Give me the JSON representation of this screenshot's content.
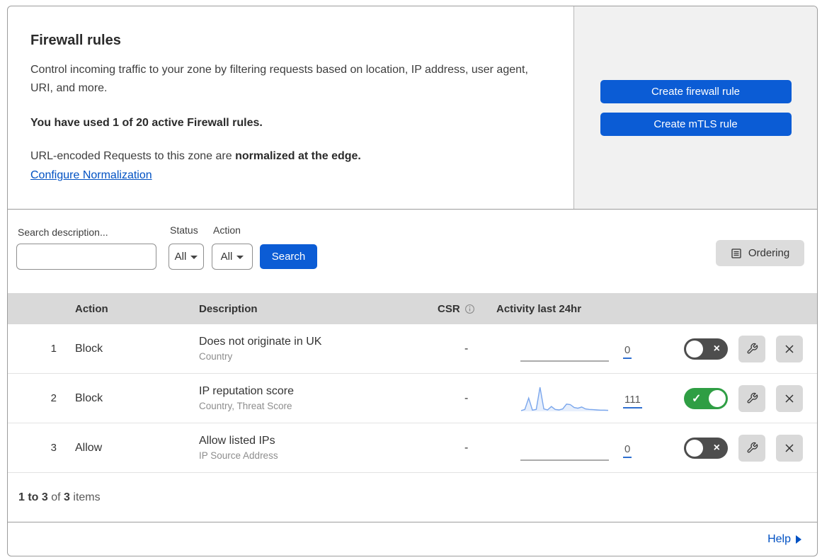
{
  "header": {
    "title": "Firewall rules",
    "description": "Control incoming traffic to your zone by filtering requests based on location, IP address, user agent, URI, and more.",
    "usage_notice": "You have used 1 of 20 active Firewall rules.",
    "normalization_prefix": "URL-encoded Requests to this zone are ",
    "normalization_bold": "normalized at the edge.",
    "normalization_link": "Configure Normalization",
    "buttons": {
      "create_firewall": "Create firewall rule",
      "create_mtls": "Create mTLS rule"
    }
  },
  "filters": {
    "search_label": "Search description...",
    "status_label": "Status",
    "status_value": "All",
    "action_label": "Action",
    "action_value": "All",
    "search_button": "Search",
    "ordering_button": "Ordering"
  },
  "table": {
    "columns": {
      "action": "Action",
      "description": "Description",
      "csr": "CSR",
      "activity": "Activity last 24hr"
    },
    "rows": [
      {
        "priority": "1",
        "action": "Block",
        "description": "Does not originate in UK",
        "criteria": "Country",
        "csr": "-",
        "activity_count": "0",
        "enabled": false
      },
      {
        "priority": "2",
        "action": "Block",
        "description": "IP reputation score",
        "criteria": "Country, Threat Score",
        "csr": "-",
        "activity_count": "111",
        "enabled": true
      },
      {
        "priority": "3",
        "action": "Allow",
        "description": "Allow listed IPs",
        "criteria": "IP Source Address",
        "csr": "-",
        "activity_count": "0",
        "enabled": false
      }
    ]
  },
  "footer": {
    "range_bold": "1 to 3",
    "of_text": " of ",
    "total_bold": "3",
    "items_text": " items",
    "help": "Help"
  },
  "ui": {
    "toggle_on_glyph": "✓",
    "toggle_off_glyph": "×"
  },
  "colors": {
    "primary_button_blue": "#0b5cd5",
    "link_blue": "#0051c3",
    "toggle_on_green": "#2f9e44",
    "toggle_off_gray": "#4d4d4d",
    "table_header_gray": "#d9d9d9",
    "side_panel_gray": "#f1f1f1",
    "sparkline_blue": "#7aa6ec"
  },
  "chart_data": {
    "type": "line",
    "title": "Activity last 24hr sparklines (one per firewall rule)",
    "xlabel": "time, last 24hr (unlabeled)",
    "ylabel": "requests (unlabeled)",
    "axes_hidden": true,
    "legend": false,
    "ylim_relative": [
      0,
      100
    ],
    "line_color": "#7aa6ec",
    "fill_color": "rgba(122,166,236,0.18)",
    "series": [
      {
        "rule": "1",
        "total": 0,
        "values": "flat-zero"
      },
      {
        "rule": "2",
        "total": 111,
        "values": [
          3,
          8,
          55,
          5,
          8,
          100,
          10,
          6,
          20,
          8,
          6,
          10,
          30,
          28,
          16,
          13,
          18,
          10,
          8,
          7,
          6,
          5,
          5,
          4
        ]
      },
      {
        "rule": "3",
        "total": 0,
        "values": "flat-zero"
      }
    ]
  }
}
